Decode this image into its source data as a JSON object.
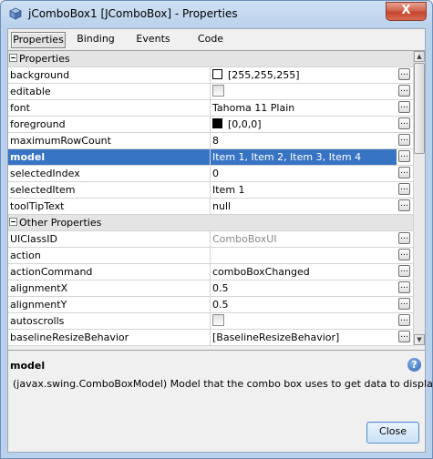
{
  "window": {
    "title": "jComboBox1 [JComboBox] - Properties",
    "icon": "cube-icon",
    "close_label": "X"
  },
  "tabs": [
    {
      "label": "Properties",
      "active": true
    },
    {
      "label": "Binding",
      "active": false
    },
    {
      "label": "Events",
      "active": false
    },
    {
      "label": "Code",
      "active": false
    }
  ],
  "sections": {
    "properties": "Properties",
    "other": "Other Properties"
  },
  "properties": [
    {
      "name": "background",
      "value": "[255,255,255]",
      "swatch": "#ffffff"
    },
    {
      "name": "editable",
      "value": "",
      "checkbox": true
    },
    {
      "name": "font",
      "value": "Tahoma 11 Plain"
    },
    {
      "name": "foreground",
      "value": "[0,0,0]",
      "swatch": "#000000"
    },
    {
      "name": "maximumRowCount",
      "value": "8"
    },
    {
      "name": "model",
      "value": "Item 1, Item 2, Item 3, Item 4",
      "selected": true
    },
    {
      "name": "selectedIndex",
      "value": "0"
    },
    {
      "name": "selectedItem",
      "value": "Item 1"
    },
    {
      "name": "toolTipText",
      "value": "null"
    }
  ],
  "other_properties": [
    {
      "name": "UIClassID",
      "value": "ComboBoxUI",
      "muted": true
    },
    {
      "name": "action",
      "value": ""
    },
    {
      "name": "actionCommand",
      "value": "comboBoxChanged"
    },
    {
      "name": "alignmentX",
      "value": "0.5"
    },
    {
      "name": "alignmentY",
      "value": "0.5"
    },
    {
      "name": "autoscrolls",
      "value": "",
      "checkbox": true
    },
    {
      "name": "baselineResizeBehavior",
      "value": "[BaselineResizeBehavior]"
    }
  ],
  "ellipsis_label": "...",
  "description": {
    "title": "model",
    "text": "(javax.swing.ComboBoxModel) Model that the combo box uses to get data to display."
  },
  "help_label": "?",
  "close_button": "Close",
  "colors": {
    "selection": "#3874c4",
    "category_bg": "#e4e4e4"
  }
}
